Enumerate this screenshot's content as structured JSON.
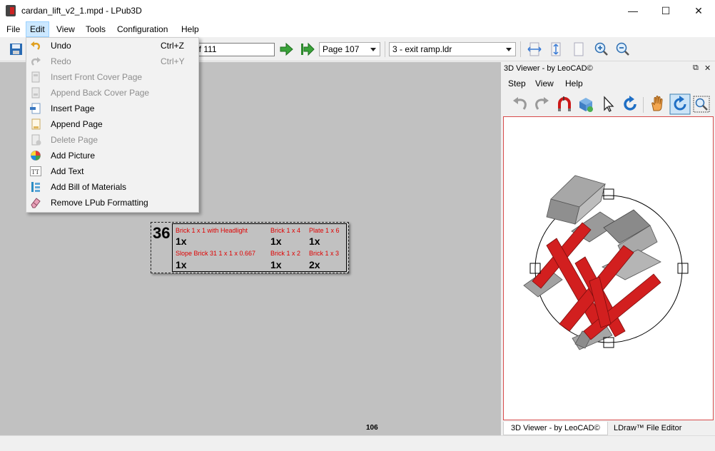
{
  "window": {
    "title": "cardan_lift_v2_1.mpd - LPub3D",
    "minimize_glyph": "—",
    "maximize_glyph": "☐",
    "close_glyph": "✕"
  },
  "menubar": {
    "items": [
      "File",
      "Edit",
      "View",
      "Tools",
      "Configuration",
      "Help"
    ]
  },
  "toolbar": {
    "page_of_text": "of 111",
    "page_combo": "Page 107",
    "submodel_combo": "3 - exit ramp.ldr"
  },
  "edit_menu": {
    "items": [
      {
        "label": "Undo",
        "shortcut": "Ctrl+Z",
        "icon": "undo-icon",
        "enabled": true
      },
      {
        "label": "Redo",
        "shortcut": "Ctrl+Y",
        "icon": "redo-icon",
        "enabled": false
      },
      {
        "label": "Insert Front Cover Page",
        "shortcut": "",
        "icon": "front-cover-icon",
        "enabled": false
      },
      {
        "label": "Append Back Cover Page",
        "shortcut": "",
        "icon": "back-cover-icon",
        "enabled": false
      },
      {
        "label": "Insert Page",
        "shortcut": "",
        "icon": "insert-page-icon",
        "enabled": true
      },
      {
        "label": "Append Page",
        "shortcut": "",
        "icon": "append-page-icon",
        "enabled": true
      },
      {
        "label": "Delete Page",
        "shortcut": "",
        "icon": "delete-page-icon",
        "enabled": false
      },
      {
        "label": "Add Picture",
        "shortcut": "",
        "icon": "picture-icon",
        "enabled": true
      },
      {
        "label": "Add Text",
        "shortcut": "",
        "icon": "text-icon",
        "enabled": true
      },
      {
        "label": "Add Bill of Materials",
        "shortcut": "",
        "icon": "bom-icon",
        "enabled": true
      },
      {
        "label": "Remove LPub Formatting",
        "shortcut": "",
        "icon": "eraser-icon",
        "enabled": true
      }
    ]
  },
  "page": {
    "step_number": "36",
    "page_number": "106",
    "parts": [
      {
        "name": "Brick  1 x  1 with Headlight",
        "qty": "1x"
      },
      {
        "name": "Brick  1 x  4",
        "qty": "1x"
      },
      {
        "name": "Plate  1 x  6",
        "qty": "1x"
      },
      {
        "name": "Slope Brick 31  1 x  1 x  0.667",
        "qty": "1x"
      },
      {
        "name": "Brick  1 x  2",
        "qty": "1x"
      },
      {
        "name": "Brick  1 x  3",
        "qty": "2x"
      }
    ]
  },
  "viewer": {
    "title": "3D Viewer - by LeoCAD©",
    "menu": [
      "Step",
      "View",
      "Help"
    ],
    "tabs": [
      "3D Viewer - by LeoCAD©",
      "LDraw™ File Editor"
    ],
    "float_glyph": "⧉",
    "close_glyph": "✕"
  },
  "colors": {
    "page_bg": "#c1c1c1",
    "part_label": "#e00000",
    "menu_highlight": "#cce8ff",
    "model_red": "#d21f1f",
    "model_gray": "#9a9a9a"
  }
}
